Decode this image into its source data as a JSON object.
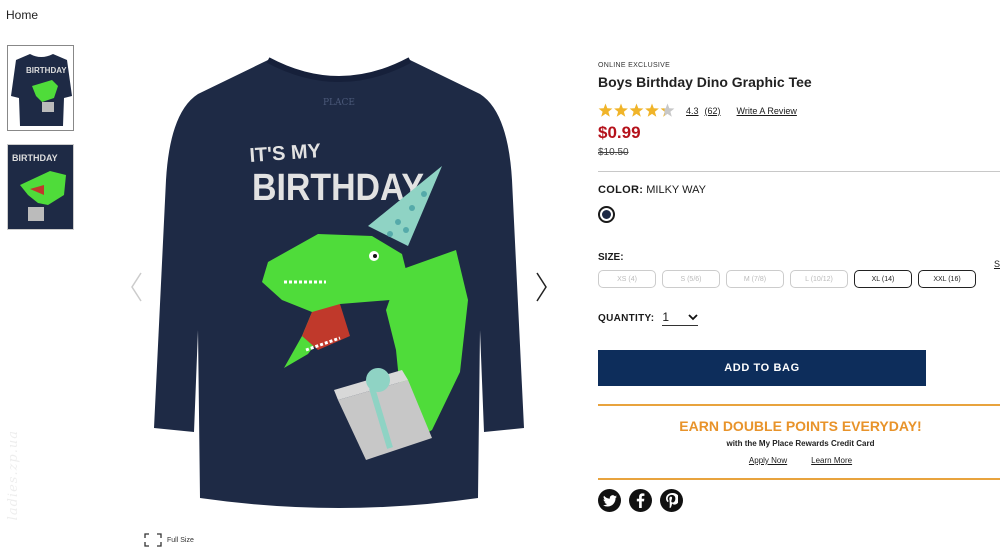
{
  "breadcrumb": {
    "home": "Home"
  },
  "gallery": {
    "full_size_label": "Full Size",
    "shirt_brand_text": "PLACE",
    "shirt_line1": "IT'S MY",
    "shirt_line2": "BIRTHDAY",
    "thumb_text": "BIRTHDAY"
  },
  "watermark": "ladies.zp.ua",
  "product": {
    "badge": "ONLINE EXCLUSIVE",
    "title": "Boys Birthday Dino Graphic Tee",
    "rating": {
      "value": "4.3",
      "count": "(62)",
      "stars": 4.3,
      "write_review": "Write A Review"
    },
    "price": "$0.99",
    "original_price": "$10.50",
    "color": {
      "label": "COLOR:",
      "value": "MILKY WAY",
      "swatch": "#1e2a45"
    },
    "size": {
      "label": "SIZE:",
      "guide": "S",
      "options": [
        {
          "label": "XS (4)",
          "available": false
        },
        {
          "label": "S (5/6)",
          "available": false
        },
        {
          "label": "M (7/8)",
          "available": false
        },
        {
          "label": "L (10/12)",
          "available": false
        },
        {
          "label": "XL (14)",
          "available": true
        },
        {
          "label": "XXL (16)",
          "available": true
        }
      ]
    },
    "quantity": {
      "label": "QUANTITY:",
      "value": "1"
    },
    "add_to_bag": "ADD TO BAG"
  },
  "promo": {
    "title": "EARN DOUBLE POINTS EVERYDAY!",
    "subtitle": "with the My Place Rewards Credit Card",
    "apply": "Apply Now",
    "learn": "Learn More"
  },
  "social": [
    "twitter-icon",
    "facebook-icon",
    "pinterest-icon"
  ],
  "colors": {
    "accent_red": "#b5121b",
    "button_navy": "#0d2d5b",
    "promo_orange": "#e8932a",
    "shirt": "#1e2a45",
    "dino_green": "#4fdc3a"
  }
}
